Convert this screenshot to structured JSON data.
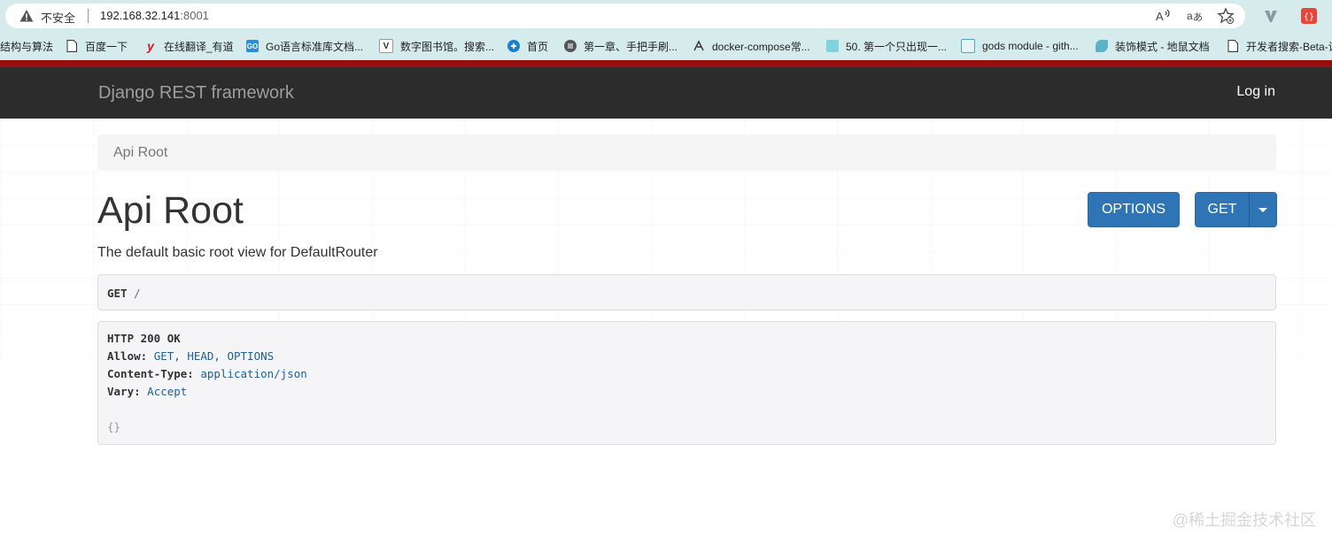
{
  "browser": {
    "insecure_label": "不安全",
    "url_host": "192.168.32.141",
    "url_port": ":8001",
    "toolbar_icons": [
      "read-aloud-icon",
      "translate-icon",
      "favorite-star-icon",
      "extension-v-icon",
      "extension-red-icon"
    ],
    "bookmarks": [
      {
        "label": "结构与算法",
        "icon": "none"
      },
      {
        "label": "百度一下",
        "icon": "page-icon"
      },
      {
        "label": "在线翻译_有道",
        "icon": "youdao-icon"
      },
      {
        "label": "Go语言标准库文档...",
        "icon": "go-icon"
      },
      {
        "label": "数字图书馆。搜索...",
        "icon": "v-icon"
      },
      {
        "label": "首页",
        "icon": "blue-circle-icon"
      },
      {
        "label": "第一章、手把手刷...",
        "icon": "book-icon"
      },
      {
        "label": "docker-compose常...",
        "icon": "leaf-icon"
      },
      {
        "label": "50. 第一个只出现一...",
        "icon": "cyan-icon"
      },
      {
        "label": "gods module - gith...",
        "icon": "gopher-icon"
      },
      {
        "label": "装饰模式 - 地鼠文档",
        "icon": "gopher-fish-icon"
      },
      {
        "label": "开发者搜索-Beta-让",
        "icon": "page-icon"
      }
    ]
  },
  "navbar": {
    "brand": "Django REST framework",
    "login": "Log in"
  },
  "breadcrumb": {
    "current": "Api Root"
  },
  "page": {
    "title": "Api Root",
    "description": "The default basic root view for DefaultRouter",
    "options_button": "OPTIONS",
    "get_button": "GET"
  },
  "request": {
    "method": "GET",
    "path": "/"
  },
  "response": {
    "status": "HTTP 200 OK",
    "headers": [
      {
        "name": "Allow:",
        "value": "GET, HEAD, OPTIONS"
      },
      {
        "name": "Content-Type:",
        "value": "application/json"
      },
      {
        "name": "Vary:",
        "value": "Accept"
      }
    ],
    "body": "{}"
  },
  "watermark": "@稀土掘金技术社区",
  "colors": {
    "navbar_bg": "#2c2c2c",
    "accent_red": "#a50e0e",
    "button_blue": "#2f75b5",
    "header_value_blue": "#1f5f99"
  }
}
